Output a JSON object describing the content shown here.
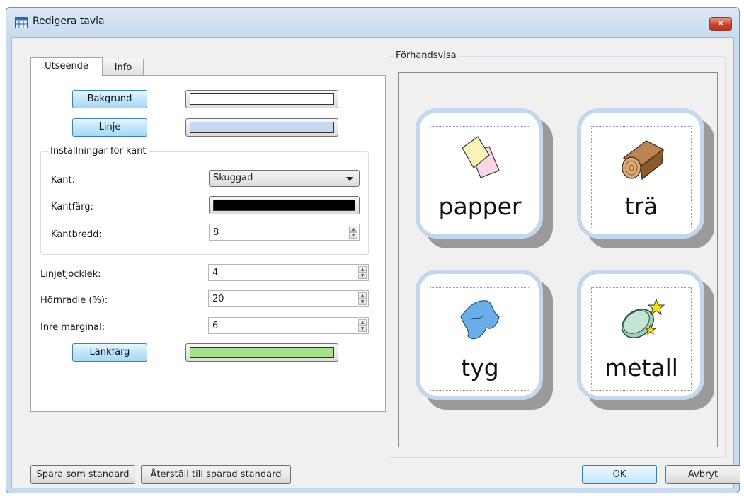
{
  "window": {
    "title": "Redigera tavla",
    "close_glyph": "✕"
  },
  "tabs": [
    {
      "label": "Utseende",
      "active": true
    },
    {
      "label": "Info",
      "active": false
    }
  ],
  "appearance": {
    "background_button": "Bakgrund",
    "background_color": "#ffffff",
    "line_button": "Linje",
    "line_color": "#c6d9f1",
    "border_group_title": "Inställningar för kant",
    "border_label": "Kant:",
    "border_value": "Skuggad",
    "border_color_label": "Kantfärg:",
    "border_color": "#000000",
    "border_width_label": "Kantbredd:",
    "border_width_value": "8",
    "line_thickness_label": "Linjetjocklek:",
    "line_thickness_value": "4",
    "corner_radius_label": "Hörnradie (%):",
    "corner_radius_value": "20",
    "inner_margin_label": "Inre marginal:",
    "inner_margin_value": "6",
    "link_color_button": "Länkfärg",
    "link_color": "#a6e28e"
  },
  "preview": {
    "title": "Förhandsvisa",
    "cells": [
      {
        "label": "papper",
        "icon": "paper-icon"
      },
      {
        "label": "trä",
        "icon": "wood-icon"
      },
      {
        "label": "tyg",
        "icon": "fabric-icon"
      },
      {
        "label": "metall",
        "icon": "metal-icon"
      }
    ]
  },
  "footer": {
    "save_default": "Spara som standard",
    "restore_default": "Återställ till sparad standard",
    "ok": "OK",
    "cancel": "Avbryt"
  }
}
